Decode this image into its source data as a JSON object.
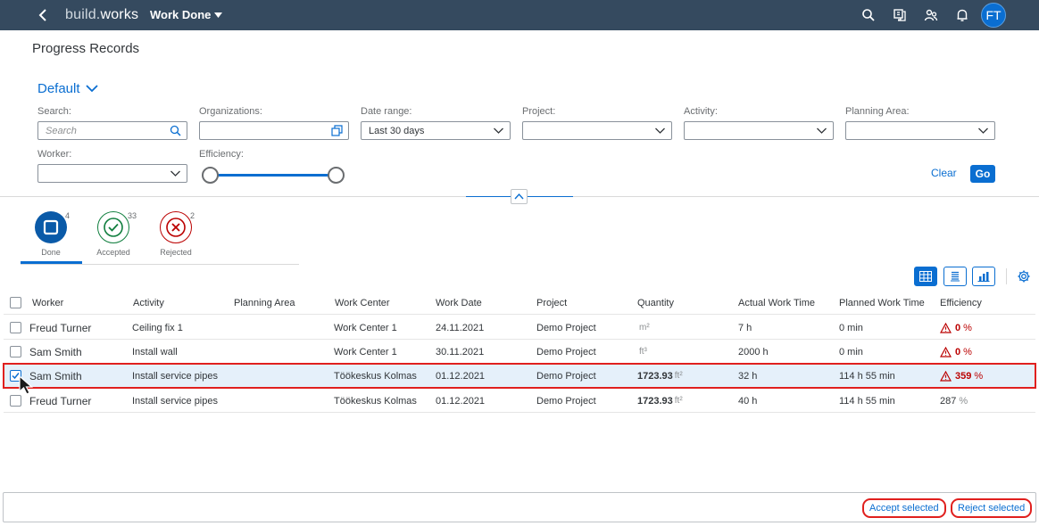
{
  "shell": {
    "brand_prefix": "build.",
    "brand_suffix": "works",
    "app_title": "Work Done",
    "avatar_initials": "FT",
    "icons": [
      "search-icon",
      "reports-icon",
      "team-icon",
      "notifications-icon"
    ]
  },
  "page_title": "Progress Records",
  "variant": "Default",
  "filters": {
    "search": {
      "label": "Search:",
      "placeholder": "Search"
    },
    "organizations": {
      "label": "Organizations:",
      "value": ""
    },
    "date_range": {
      "label": "Date range:",
      "value": "Last 30 days"
    },
    "project": {
      "label": "Project:",
      "value": ""
    },
    "activity": {
      "label": "Activity:",
      "value": ""
    },
    "planning_area": {
      "label": "Planning Area:",
      "value": ""
    },
    "worker": {
      "label": "Worker:",
      "value": ""
    },
    "efficiency": {
      "label": "Efficiency:"
    },
    "clear_label": "Clear",
    "go_label": "Go"
  },
  "status_tabs": [
    {
      "label": "Done",
      "count": "4",
      "selected": true
    },
    {
      "label": "Accepted",
      "count": "33",
      "selected": false
    },
    {
      "label": "Rejected",
      "count": "2",
      "selected": false
    }
  ],
  "table": {
    "columns": [
      "Worker",
      "Activity",
      "Planning Area",
      "Work Center",
      "Work Date",
      "Project",
      "Quantity",
      "Actual Work Time",
      "Planned Work Time",
      "Efficiency"
    ],
    "rows": [
      {
        "worker": "Freud Turner",
        "activity": "Ceiling fix 1",
        "planning_area": "",
        "work_center": "Work Center 1",
        "work_date": "24.11.2021",
        "project": "Demo Project",
        "quantity": "",
        "unit": "m²",
        "actual": "7 h",
        "planned": "0 min",
        "efficiency": "0",
        "eff_unit": "%",
        "warning": true,
        "checked": false
      },
      {
        "worker": "Sam Smith",
        "activity": "Install wall",
        "planning_area": "",
        "work_center": "Work Center 1",
        "work_date": "30.11.2021",
        "project": "Demo Project",
        "quantity": "",
        "unit": "ft³",
        "actual": "2000 h",
        "planned": "0 min",
        "efficiency": "0",
        "eff_unit": "%",
        "warning": true,
        "checked": false
      },
      {
        "worker": "Sam Smith",
        "activity": "Install service pipes",
        "planning_area": "",
        "work_center": "Töökeskus Kolmas",
        "work_date": "01.12.2021",
        "project": "Demo Project",
        "quantity": "1723.93",
        "unit": "ft²",
        "actual": "32 h",
        "planned": "114 h 55 min",
        "efficiency": "359",
        "eff_unit": "%",
        "warning": true,
        "checked": true
      },
      {
        "worker": "Freud Turner",
        "activity": "Install service pipes",
        "planning_area": "",
        "work_center": "Töökeskus Kolmas",
        "work_date": "01.12.2021",
        "project": "Demo Project",
        "quantity": "1723.93",
        "unit": "ft²",
        "actual": "40 h",
        "planned": "114 h 55 min",
        "efficiency": "287",
        "eff_unit": "%",
        "warning": false,
        "checked": false
      }
    ]
  },
  "footer": {
    "accept_label": "Accept selected",
    "reject_label": "Reject selected"
  },
  "colors": {
    "shell": "#354a5f",
    "accent": "#0a6ed1",
    "error": "#bb0000",
    "success": "#107e3e",
    "highlight": "#e0201e"
  }
}
